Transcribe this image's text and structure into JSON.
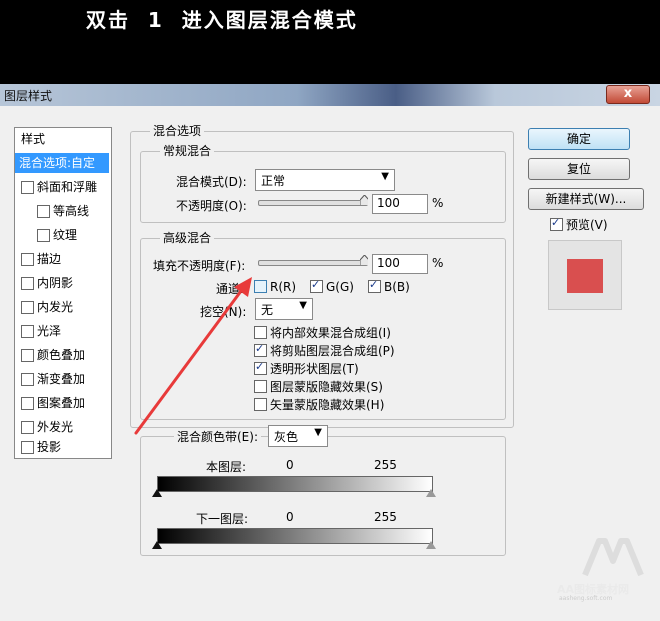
{
  "banner": {
    "title": "双击  1  进入图层混合模式"
  },
  "window": {
    "title": "图层样式",
    "close": "x"
  },
  "left_panel": {
    "header": "样式",
    "selected": "混合选项:自定",
    "items": [
      {
        "label": "斜面和浮雕",
        "checked": false
      },
      {
        "label": "等高线",
        "checked": false
      },
      {
        "label": "纹理",
        "checked": false
      },
      {
        "label": "描边",
        "checked": false
      },
      {
        "label": "内阴影",
        "checked": false
      },
      {
        "label": "内发光",
        "checked": false
      },
      {
        "label": "光泽",
        "checked": false
      },
      {
        "label": "颜色叠加",
        "checked": false
      },
      {
        "label": "渐变叠加",
        "checked": false
      },
      {
        "label": "图案叠加",
        "checked": false
      },
      {
        "label": "外发光",
        "checked": false
      },
      {
        "label": "投影",
        "checked": false
      }
    ]
  },
  "blend_options": {
    "legend": "混合选项",
    "general": {
      "legend": "常规混合",
      "mode_label": "混合模式(D):",
      "mode_value": "正常",
      "opacity_label": "不透明度(O):",
      "opacity_value": "100",
      "opacity_unit": "%"
    },
    "advanced": {
      "legend": "高级混合",
      "fill_label": "填充不透明度(F):",
      "fill_value": "100",
      "fill_unit": "%",
      "channels_label": "通道:",
      "channel_r": {
        "label": "R(R)",
        "checked": false
      },
      "channel_g": {
        "label": "G(G)",
        "checked": true
      },
      "channel_b": {
        "label": "B(B)",
        "checked": true
      },
      "knockout_label": "挖空(N):",
      "knockout_value": "无",
      "options": [
        {
          "label": "将内部效果混合成组(I)",
          "checked": false
        },
        {
          "label": "将剪贴图层混合成组(P)",
          "checked": true
        },
        {
          "label": "透明形状图层(T)",
          "checked": true
        },
        {
          "label": "图层蒙版隐藏效果(S)",
          "checked": false
        },
        {
          "label": "矢量蒙版隐藏效果(H)",
          "checked": false
        }
      ]
    },
    "blend_if": {
      "label": "混合颜色带(E):",
      "value": "灰色",
      "this_layer": {
        "label": "本图层:",
        "min": "0",
        "max": "255"
      },
      "underlying": {
        "label": "下一图层:",
        "min": "0",
        "max": "255"
      }
    }
  },
  "buttons": {
    "ok": "确定",
    "reset": "复位",
    "new_style": "新建样式(W)...",
    "preview_label": "预览(V)",
    "preview_checked": true
  },
  "preview_color": "#d94f4f",
  "annotation_arrow_color": "#e83a3a",
  "watermark": {
    "text": "AA图标素材网",
    "subtext": "aasheng.soft.com"
  }
}
